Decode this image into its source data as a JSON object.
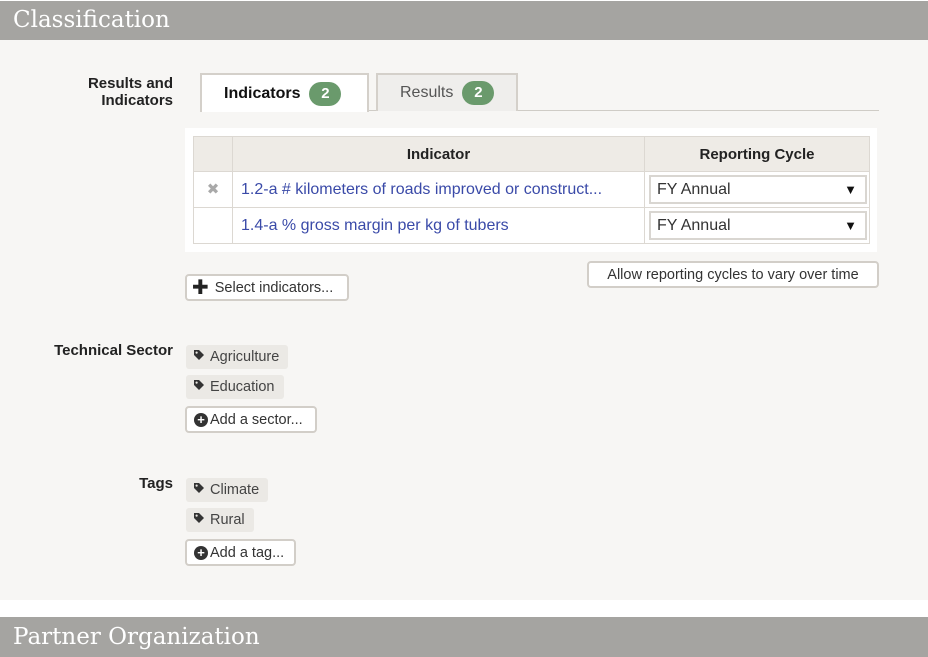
{
  "sections": {
    "classification": "Classification",
    "partner": "Partner Organization"
  },
  "results_indicators": {
    "label": "Results and Indicators",
    "tabs": [
      {
        "label": "Indicators",
        "count": "2",
        "active": true
      },
      {
        "label": "Results",
        "count": "2",
        "active": false
      }
    ],
    "table": {
      "headers": {
        "indicator": "Indicator",
        "cycle": "Reporting Cycle"
      },
      "rows": [
        {
          "remove": "✖",
          "indicator": "1.2-a # kilometers of roads improved or construct...",
          "cycle": "FY Annual"
        },
        {
          "remove": "",
          "indicator": "1.4-a % gross margin per kg of tubers",
          "cycle": "FY Annual"
        }
      ]
    },
    "select_button": "Select indicators...",
    "allow_button": "Allow reporting cycles to vary over time"
  },
  "technical_sector": {
    "label": "Technical Sector",
    "items": [
      "Agriculture",
      "Education"
    ],
    "add_button": "Add a sector..."
  },
  "tags": {
    "label": "Tags",
    "items": [
      "Climate",
      "Rural"
    ],
    "add_button": "Add a tag..."
  },
  "icons": {
    "tag": "tag-icon",
    "add": "plus-circle-icon",
    "plus": "plus-icon",
    "remove": "close-icon",
    "dropdown": "caret-down-icon"
  },
  "colors": {
    "header_bg": "#a5a4a1",
    "badge_green": "#6a9a6c",
    "link_blue": "#3a4aa8"
  }
}
